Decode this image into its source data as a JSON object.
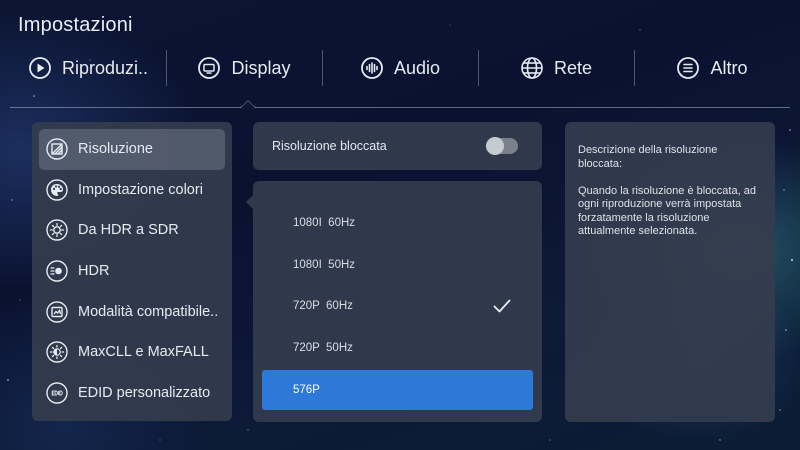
{
  "app": {
    "title": "Impostazioni"
  },
  "tabs": [
    {
      "label": "Riproduzi..",
      "icon": "play-icon"
    },
    {
      "label": "Display",
      "icon": "display-icon"
    },
    {
      "label": "Audio",
      "icon": "audio-icon"
    },
    {
      "label": "Rete",
      "icon": "globe-icon"
    },
    {
      "label": "Altro",
      "icon": "menu-icon"
    }
  ],
  "active_tab": "Display",
  "sidebar": {
    "items": [
      {
        "label": "Risoluzione",
        "icon": "resolution-icon"
      },
      {
        "label": "Impostazione colori",
        "icon": "palette-icon"
      },
      {
        "label": "Da HDR a SDR",
        "icon": "hdr-to-sdr-icon"
      },
      {
        "label": "HDR",
        "icon": "hdr-icon"
      },
      {
        "label": "Modalità compatibile..",
        "icon": "compat-mode-icon"
      },
      {
        "label": "MaxCLL e MaxFALL",
        "icon": "brightness-icon"
      },
      {
        "label": "EDID personalizzato",
        "icon": "edid-icon"
      }
    ],
    "active_item": "Risoluzione"
  },
  "resolution_lock": {
    "label": "Risoluzione bloccata",
    "enabled": false
  },
  "resolutions": {
    "options": [
      {
        "label": "1080I  60Hz",
        "checked": false,
        "selected": false
      },
      {
        "label": "1080I  50Hz",
        "checked": false,
        "selected": false
      },
      {
        "label": "720P  60Hz",
        "checked": true,
        "selected": false
      },
      {
        "label": "720P  50Hz",
        "checked": false,
        "selected": false
      },
      {
        "label": "576P",
        "checked": false,
        "selected": true
      }
    ]
  },
  "description": {
    "title": "Descrizione della risoluzione bloccata:",
    "body": "Quando la risoluzione è bloccata, ad ogni riproduzione verrà impostata forzatamente la risoluzione attualmente selezionata."
  },
  "colors": {
    "accent": "#2d79d8",
    "panel": "#343c4e",
    "text": "#e6eaf1"
  }
}
